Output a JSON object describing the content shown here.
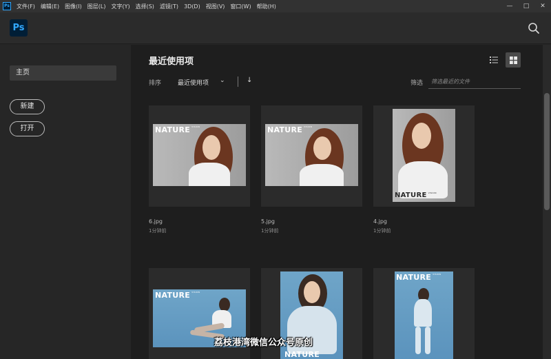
{
  "menubar": {
    "app_icon": "Ps",
    "items": [
      "文件(F)",
      "编辑(E)",
      "图像(I)",
      "图层(L)",
      "文字(Y)",
      "选择(S)",
      "滤镜(T)",
      "3D(D)",
      "视图(V)",
      "窗口(W)",
      "帮助(H)"
    ],
    "window_controls": [
      "minimize-icon",
      "restore-icon",
      "close-icon"
    ]
  },
  "header": {
    "logo": "Ps",
    "search_icon": "search-icon"
  },
  "sidebar": {
    "home_label": "主页",
    "new_label": "新建",
    "open_label": "打开"
  },
  "main": {
    "title": "最近使用项",
    "sort_label": "排序",
    "sort_value": "最近使用项",
    "sort_direction_icon": "arrow-down-icon",
    "filter_label": "筛选",
    "filter_placeholder": "筛选最近的文件",
    "view_modes": [
      "list-view-icon",
      "grid-view-icon"
    ],
    "selected_view": "grid"
  },
  "files": [
    {
      "name": "6.jpg",
      "time": "1分钟前",
      "photo_title": "NATURE",
      "photo_subtitle": "VISION"
    },
    {
      "name": "5.jpg",
      "time": "1分钟前",
      "photo_title": "NATURE",
      "photo_subtitle": "VISION"
    },
    {
      "name": "4.jpg",
      "time": "1分钟前",
      "photo_title": "NATURE",
      "photo_subtitle": "VISION"
    },
    {
      "photo_title": "NATURE",
      "photo_subtitle": "VISION"
    },
    {
      "photo_title": "NATURE"
    },
    {
      "photo_title": "NATURE",
      "photo_subtitle": "VISION"
    }
  ],
  "watermark": "荔枝港湾微信公众号原创",
  "colors": {
    "accent": "#31a8ff",
    "logo_bg": "#001e36",
    "app_bg": "#1e1e1e"
  }
}
